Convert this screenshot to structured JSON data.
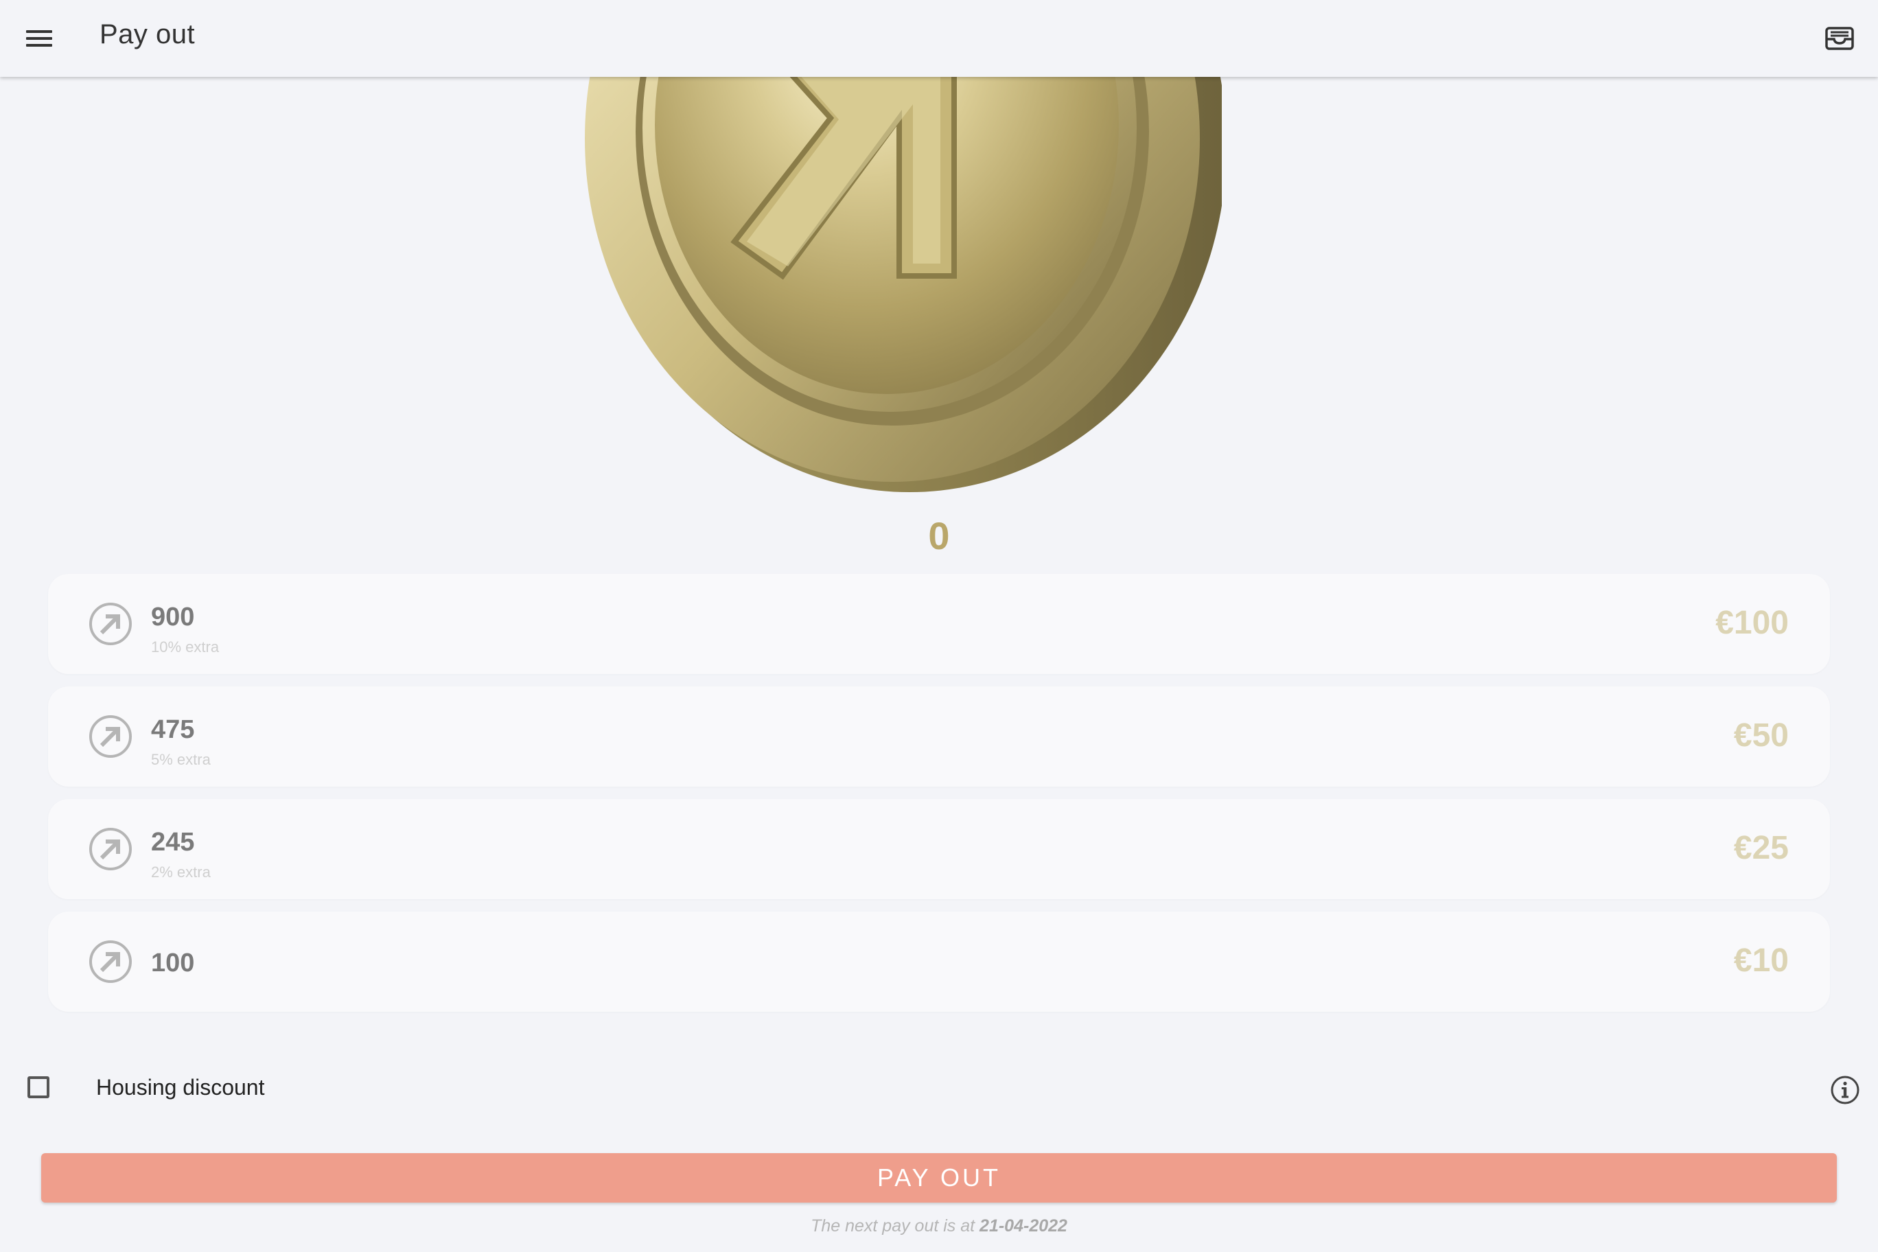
{
  "app_bar": {
    "title": "Pay out",
    "menu_icon": "menu-icon",
    "inbox_icon": "inbox-icon"
  },
  "coin": {
    "icon": "coin-logo-icon",
    "balance": "0",
    "color": "#b9a66a"
  },
  "offers": [
    {
      "amount": "900",
      "extra": "10% extra",
      "price": "€100"
    },
    {
      "amount": "475",
      "extra": "5% extra",
      "price": "€50"
    },
    {
      "amount": "245",
      "extra": "2% extra",
      "price": "€25"
    },
    {
      "amount": "100",
      "extra": "",
      "price": "€10"
    }
  ],
  "housing": {
    "label": "Housing discount",
    "checked": false,
    "info_icon": "info-icon"
  },
  "payout": {
    "button_label": "PAY OUT",
    "button_color": "#ef9e8c",
    "next_prefix": "The next pay out is at ",
    "next_date": "21-04-2022"
  },
  "colors": {
    "background": "#f3f4f8",
    "price": "#dcd4b4",
    "amount": "#7a7a7a"
  }
}
